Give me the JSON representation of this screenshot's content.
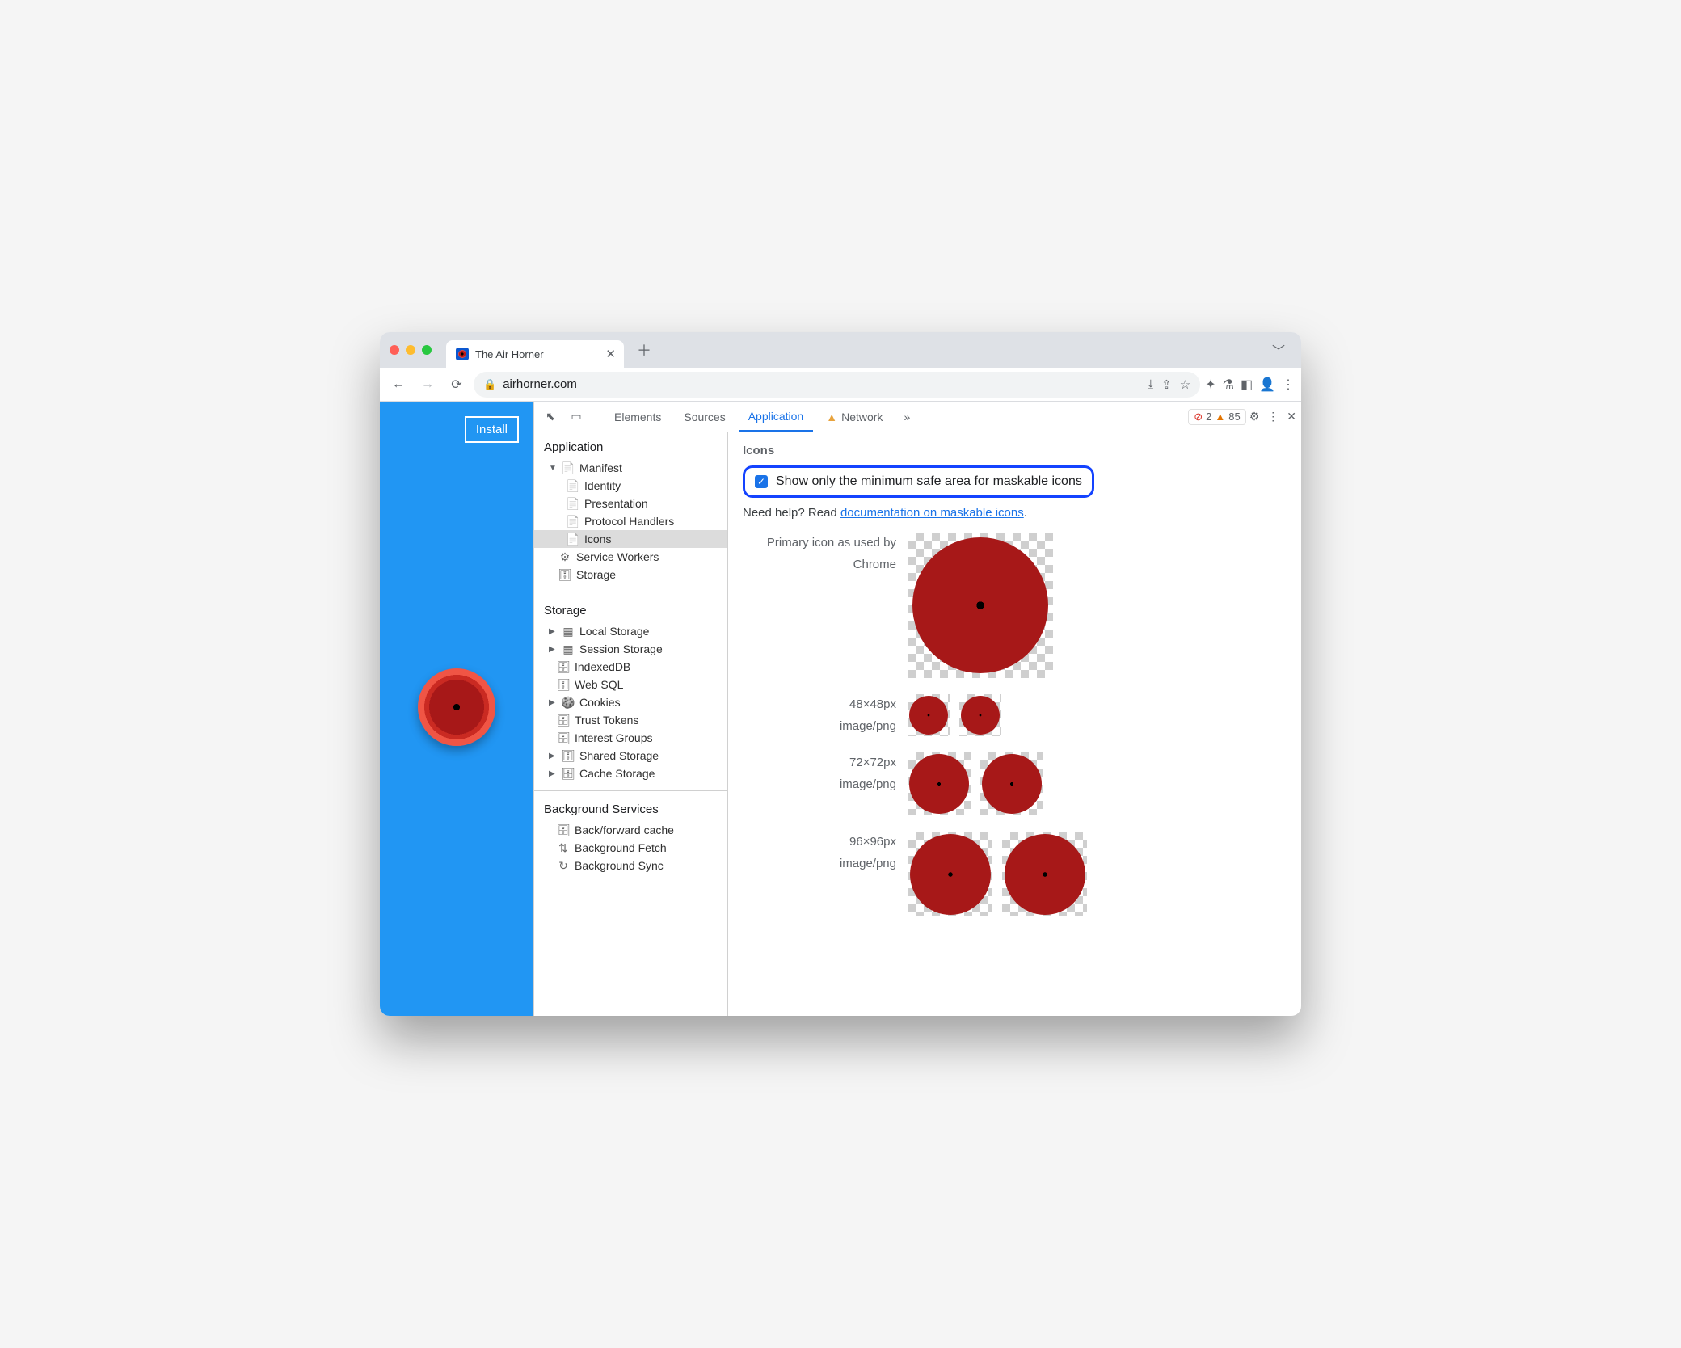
{
  "tab": {
    "title": "The Air Horner"
  },
  "url": {
    "host": "airhorner.com"
  },
  "page": {
    "install": "Install"
  },
  "devtools": {
    "tabs": {
      "elements": "Elements",
      "sources": "Sources",
      "application": "Application",
      "network": "Network"
    },
    "errors": "2",
    "warnings": "85"
  },
  "sidebar": {
    "sec1": "Application",
    "manifest": "Manifest",
    "identity": "Identity",
    "presentation": "Presentation",
    "protocol": "Protocol Handlers",
    "icons": "Icons",
    "sw": "Service Workers",
    "storageItem": "Storage",
    "sec2": "Storage",
    "local": "Local Storage",
    "session": "Session Storage",
    "idb": "IndexedDB",
    "websql": "Web SQL",
    "cookies": "Cookies",
    "trust": "Trust Tokens",
    "interest": "Interest Groups",
    "shared": "Shared Storage",
    "cache": "Cache Storage",
    "sec3": "Background Services",
    "bfc": "Back/forward cache",
    "bgfetch": "Background Fetch",
    "bgsync": "Background Sync"
  },
  "content": {
    "heading": "Icons",
    "checkbox": "Show only the minimum safe area for maskable icons",
    "helpPrefix": "Need help? Read ",
    "helpLink": "documentation on maskable icons",
    "helpSuffix": ".",
    "primary_l1": "Primary icon as used by",
    "primary_l2": "Chrome",
    "s48": "48×48px",
    "s72": "72×72px",
    "s96": "96×96px",
    "mime": "image/png"
  }
}
